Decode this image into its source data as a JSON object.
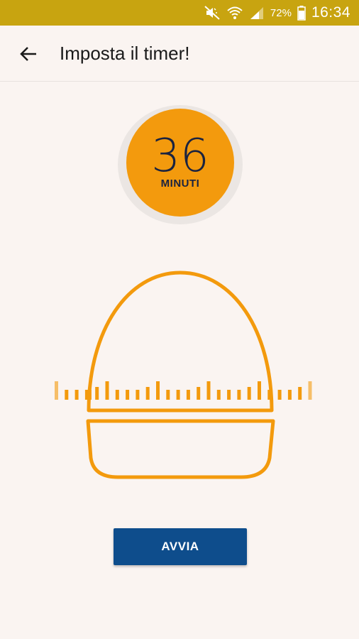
{
  "status_bar": {
    "battery_percent": "72%",
    "time": "16:34",
    "icons": [
      "mute-icon",
      "wifi-icon",
      "signal-icon",
      "battery-icon"
    ]
  },
  "header": {
    "back_icon": "arrow-left-icon",
    "title": "Imposta il timer!"
  },
  "timer": {
    "value": "36",
    "unit": "MINUTI"
  },
  "dial": {
    "icon": "egg-timer-icon"
  },
  "actions": {
    "start_label": "AVVIA"
  },
  "colors": {
    "status_bar": "#c8a410",
    "accent_orange": "#f39a0d",
    "button_blue": "#0e4d8c",
    "background": "#faf4f1",
    "text_dark": "#1a2340"
  }
}
